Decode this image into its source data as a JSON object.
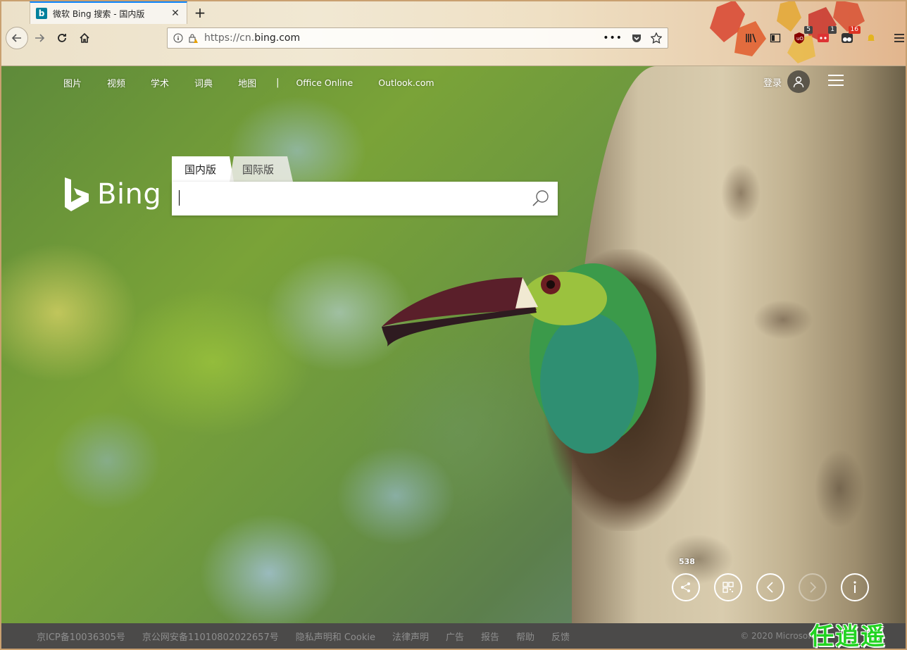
{
  "browser": {
    "tab_title": "微软 Bing 搜索 - 国内版",
    "tab_favicon": "b",
    "new_tab": "+",
    "url_host_prefix": "https://cn.",
    "url_host_main": "bing.com",
    "extension_badges": {
      "ublock": "5",
      "ext2": "1",
      "ext3": "16"
    }
  },
  "nav": {
    "items": [
      "图片",
      "视频",
      "学术",
      "词典",
      "地图"
    ],
    "separator": "|",
    "office": "Office Online",
    "outlook": "Outlook.com",
    "signin": "登录"
  },
  "logo": {
    "wordmark": "Bing"
  },
  "search": {
    "tab_active": "国内版",
    "tab_inactive": "国际版",
    "value": "",
    "placeholder": ""
  },
  "hero": {
    "share_count": "538"
  },
  "footer": {
    "icp": "京ICP备10036305号",
    "police": "京公网安备11010802022657号",
    "privacy": "隐私声明和 Cookie",
    "legal": "法律声明",
    "ads": "广告",
    "report": "报告",
    "help": "帮助",
    "feedback": "反馈",
    "copyright": "© 2020 Microsoft"
  },
  "watermark": "任逍遥",
  "colors": {
    "accent": "#0a84ff",
    "bing_teal": "#00809d",
    "watermark": "#22d322"
  }
}
